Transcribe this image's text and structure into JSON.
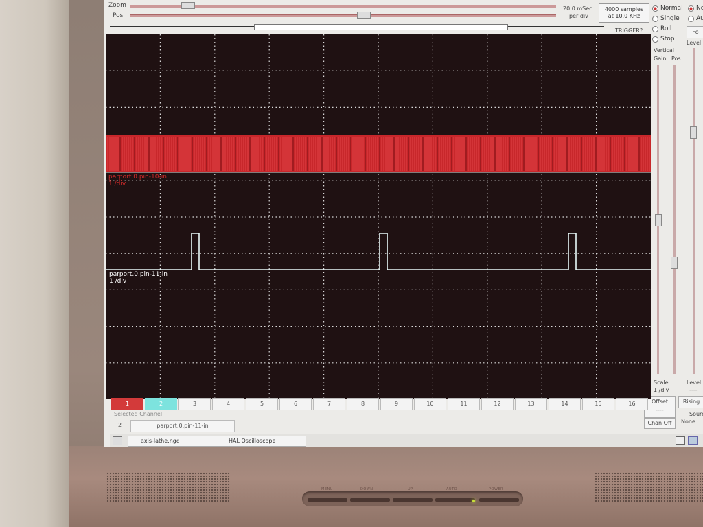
{
  "top_controls": {
    "zoom_label": "Zoom",
    "pos_label": "Pos",
    "time_per_div": "20.0 mSec",
    "per_div": "per div",
    "samples": "4000 samples",
    "sample_rate": "at 10.0 KHz",
    "trigger_label": "TRIGGER?"
  },
  "run_mode": {
    "options": [
      "Normal",
      "Single",
      "Roll",
      "Stop"
    ],
    "selected": "Normal"
  },
  "trigger_mode": {
    "options": [
      "No",
      "Au"
    ],
    "selected": "No",
    "force_label": "Fo",
    "level_label": "Level"
  },
  "vertical": {
    "title": "Vertical",
    "gain_label": "Gain",
    "pos_label": "Pos",
    "scale_label": "Scale",
    "scale_value": "1 /div",
    "level_label": "Level",
    "level_value": "----",
    "offset_label": "Offset",
    "offset_value": "----",
    "rising_label": "Rising",
    "chan_off_label": "Chan Off",
    "source_label": "Source",
    "source_value": "None"
  },
  "traces": [
    {
      "name": "parport.0.pin-10-in",
      "scale": "1 /div",
      "color": "#d12a2a"
    },
    {
      "name": "parport.0.pin-11-in",
      "scale": "1 /div",
      "color": "#e8f6f6"
    }
  ],
  "channels": [
    "1",
    "2",
    "3",
    "4",
    "5",
    "6",
    "7",
    "8",
    "9",
    "10",
    "11",
    "12",
    "13",
    "14",
    "15",
    "16"
  ],
  "channel_colors": {
    "1": "#d33a3a",
    "2": "#7de3de"
  },
  "selected_channel": {
    "label": "Selected Channel",
    "number": "2",
    "name": "parport.0.pin-11-in"
  },
  "taskbar": {
    "items": [
      "axis-lathe.ngc",
      "HAL Oscilloscope"
    ]
  },
  "monitor_buttons": [
    "MENU",
    "DOWN",
    "UP",
    "AUTO",
    "POWER"
  ]
}
